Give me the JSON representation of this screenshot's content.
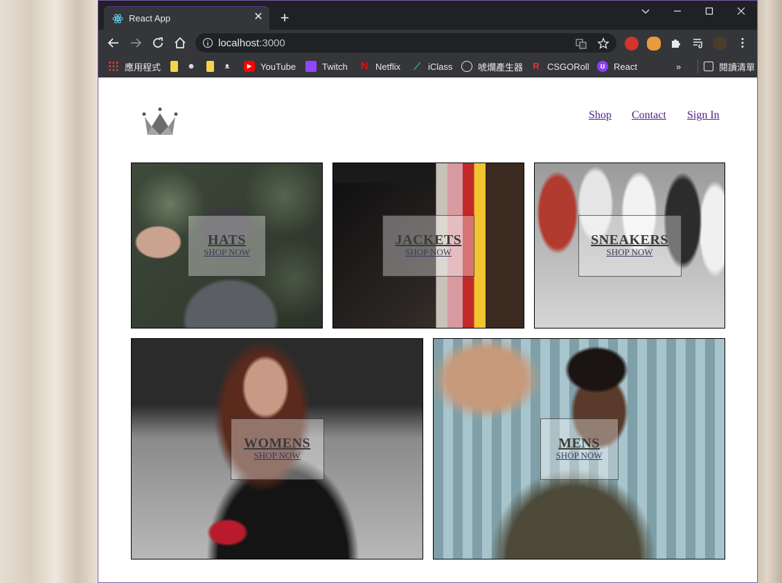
{
  "browser": {
    "tab_title": "React App",
    "url_host": "localhost",
    "url_port": ":3000",
    "bookmarks": [
      "應用程式",
      "YouTube",
      "Twitch",
      "Netflix",
      "iClass",
      "唬爛產生器",
      "CSGORoll",
      "React"
    ],
    "reading_list": "閱讀清單"
  },
  "site": {
    "nav": {
      "shop": "Shop",
      "contact": "Contact",
      "sign_in": "Sign In"
    },
    "categories": [
      {
        "title": "HATS",
        "cta": "SHOP NOW"
      },
      {
        "title": "JACKETS",
        "cta": "SHOP NOW"
      },
      {
        "title": "SNEAKERS",
        "cta": "SHOP NOW"
      },
      {
        "title": "WOMENS",
        "cta": "SHOP NOW"
      },
      {
        "title": "MENS",
        "cta": "SHOP NOW"
      }
    ]
  },
  "colors": {
    "link": "#551a8b",
    "chrome_dark": "#202124",
    "chrome_mid": "#35363a"
  }
}
